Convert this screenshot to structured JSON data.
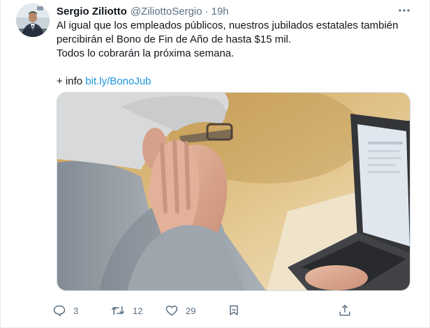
{
  "author": {
    "name": "Sergio Ziliotto",
    "handle": "@ZiliottoSergio",
    "separator": "·",
    "time": "19h"
  },
  "tweet": {
    "lines": [
      "Al igual que los empleados públicos, nuestros jubilados estatales también",
      "percibirán el Bono de Fin de Año de hasta $15 mil.",
      "Todos lo cobrarán la próxima semana."
    ],
    "info_prefix": "+ info ",
    "link_text": "bit.ly/BonoJub"
  },
  "actions": {
    "reply_count": "3",
    "retweet_count": "12",
    "like_count": "29"
  },
  "icons": {
    "more": "more-horizontal-icon",
    "reply": "reply-icon",
    "retweet": "retweet-icon",
    "like": "heart-icon",
    "bookmark": "bookmark-icon",
    "share": "share-icon"
  },
  "colors": {
    "link": "#1b95e0",
    "secondary_text": "#5b7083",
    "primary_text": "#0f1419",
    "border": "#e6ecf0"
  }
}
